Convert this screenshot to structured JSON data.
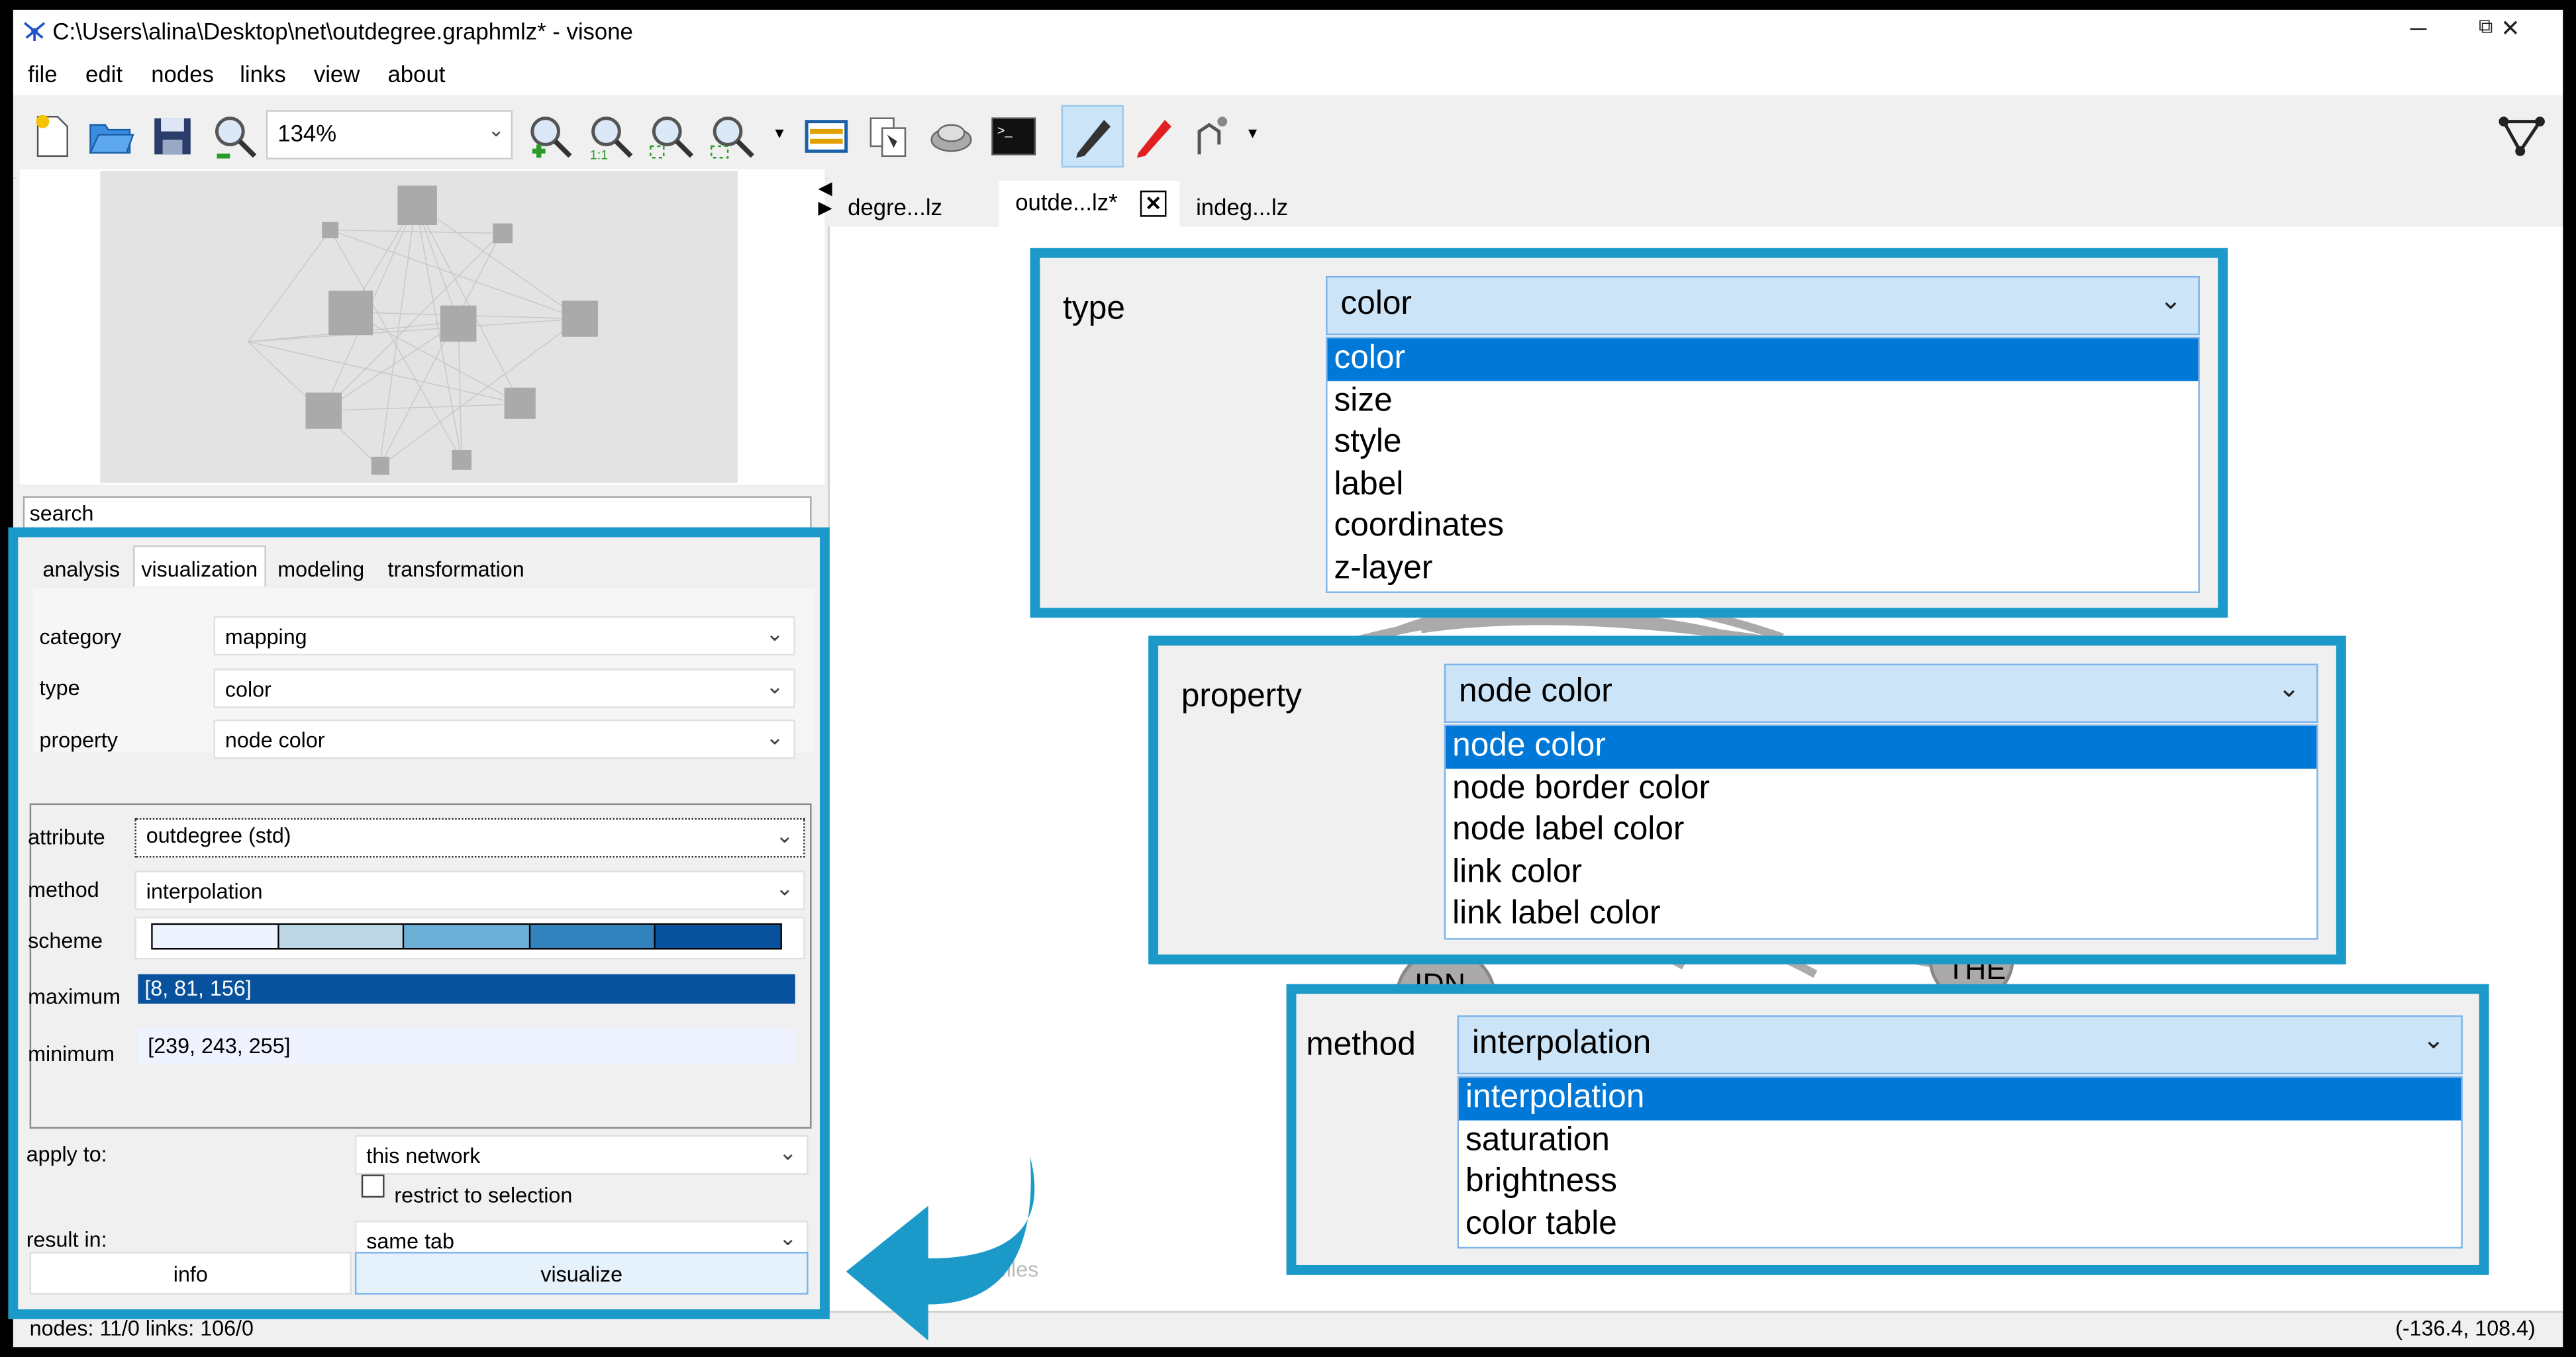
{
  "window": {
    "title": "C:\\Users\\alina\\Desktop\\net\\outdegree.graphmlz* - visone",
    "minimize": "─",
    "maximize": "⧉",
    "close": "✕"
  },
  "menu": [
    "file",
    "edit",
    "nodes",
    "links",
    "view",
    "about"
  ],
  "toolbar": {
    "zoom": "134%"
  },
  "search": {
    "placeholder": "search"
  },
  "side_tabs": [
    "analysis",
    "visualization",
    "modeling",
    "transformation"
  ],
  "fields": {
    "category_label": "category",
    "category_value": "mapping",
    "type_label": "type",
    "type_value": "color",
    "property_label": "property",
    "property_value": "node color",
    "attribute_label": "attribute",
    "attribute_value": "outdegree (std)",
    "method_label": "method",
    "method_value": "interpolation",
    "scheme_label": "scheme",
    "maximum_label": "maximum",
    "maximum_value": "[8, 81, 156]",
    "minimum_label": "minimum",
    "minimum_value": "[239, 243, 255]",
    "apply_label": "apply to:",
    "apply_value": "this network",
    "restrict_label": "restrict to selection",
    "result_label": "result in:",
    "result_value": "same tab"
  },
  "scheme_colors": [
    "#eff3ff",
    "#bdd7e7",
    "#6baed6",
    "#3182bd",
    "#08519c"
  ],
  "buttons": {
    "info": "info",
    "visualize": "visualize"
  },
  "document_tabs": [
    "degre...lz",
    "outde...lz*",
    "indeg...lz"
  ],
  "status": {
    "left": "nodes: 11/0  links: 106/0",
    "right": "(-136.4, 108.4)"
  },
  "canvas_text": {
    "node_a": "IDN",
    "node_b": "THE",
    "files": "files"
  },
  "callouts": {
    "type": {
      "label": "type",
      "value": "color",
      "options": [
        "color",
        "size",
        "style",
        "label",
        "coordinates",
        "z-layer"
      ]
    },
    "property": {
      "label": "property",
      "value": "node color",
      "options": [
        "node color",
        "node border color",
        "node label color",
        "link color",
        "link label color"
      ]
    },
    "method": {
      "label": "method",
      "value": "interpolation",
      "options": [
        "interpolation",
        "saturation",
        "brightness",
        "color table"
      ]
    }
  },
  "colors": {
    "highlight": "#1b9ac9",
    "selection": "#0078d7",
    "combo_active": "#cce4f7"
  }
}
